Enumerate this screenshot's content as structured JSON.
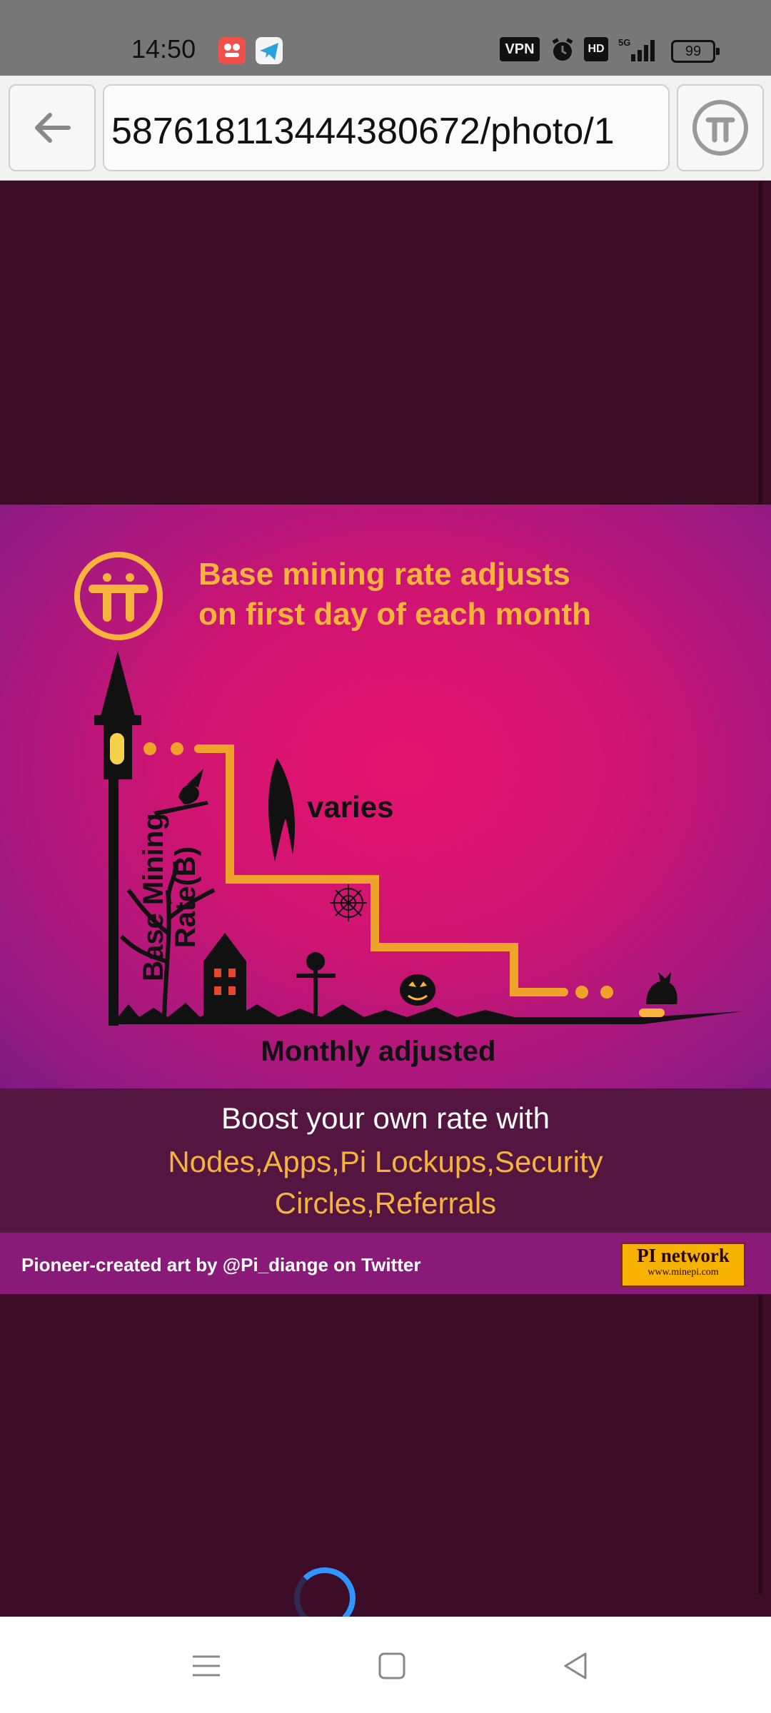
{
  "status_bar": {
    "time": "14:50",
    "vpn": "VPN",
    "hd": "HD",
    "network": "5G",
    "battery": "99",
    "icons": [
      "app-icon",
      "telegram-icon",
      "alarm-icon",
      "signal-icon",
      "battery-icon"
    ]
  },
  "browser": {
    "url": "587618113444380672/photo/1",
    "back_icon": "back-arrow-icon",
    "pi_icon": "pi-logo-icon"
  },
  "poster": {
    "headline_1": "Base mining rate adjusts",
    "headline_2": "on first day of each month",
    "y_axis_label": "Base Mining Rate(B)",
    "x_axis_label": "Monthly adjusted",
    "annotation": "varies",
    "boost_line1": "Boost your own rate with",
    "boost_line2": "Nodes,Apps,Pi Lockups,Security Circles,Referrals",
    "credit": "Pioneer-created art by @Pi_diange on Twitter",
    "brand_name": "PI network",
    "brand_url": "www.minepi.com",
    "colors": {
      "accent": "#f7b33c",
      "magenta": "#d0146f",
      "purple": "#7c1a82",
      "dark": "#3d0d28"
    }
  },
  "nav_bar": {
    "icons": [
      "menu-icon",
      "home-icon",
      "back-icon"
    ]
  }
}
